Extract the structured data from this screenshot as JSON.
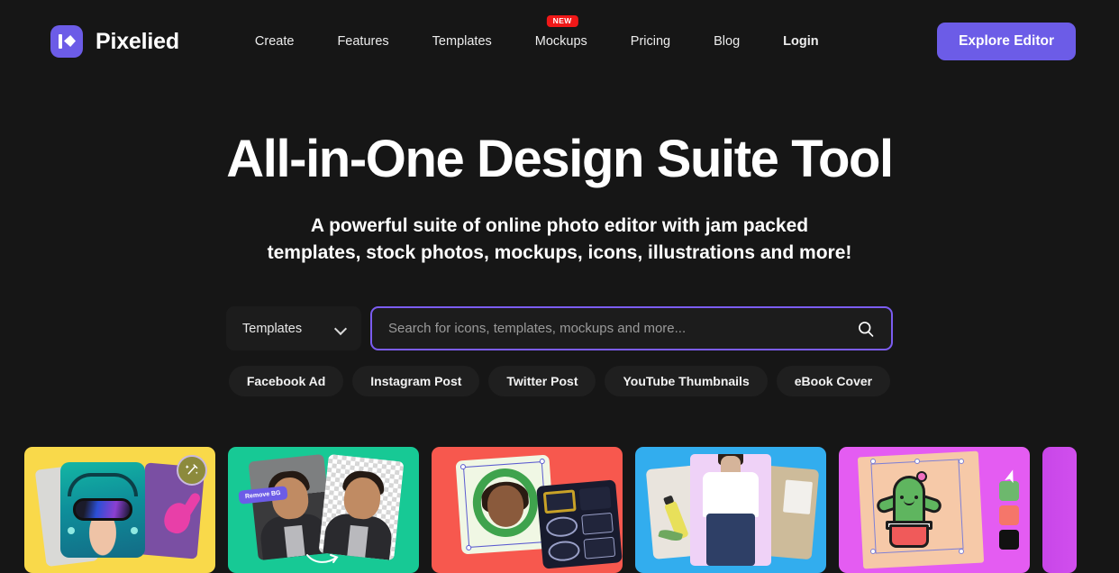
{
  "brand": {
    "name": "Pixelied",
    "logo_icon": "pixelied-logo-icon"
  },
  "nav": {
    "items": [
      {
        "label": "Create",
        "bold": false,
        "badge": ""
      },
      {
        "label": "Features",
        "bold": false,
        "badge": ""
      },
      {
        "label": "Templates",
        "bold": false,
        "badge": ""
      },
      {
        "label": "Mockups",
        "bold": false,
        "badge": "NEW"
      },
      {
        "label": "Pricing",
        "bold": false,
        "badge": ""
      },
      {
        "label": "Blog",
        "bold": false,
        "badge": ""
      },
      {
        "label": "Login",
        "bold": true,
        "badge": ""
      }
    ],
    "cta_label": "Explore Editor"
  },
  "hero": {
    "title": "All-in-One Design Suite Tool",
    "subtitle_line1": "A powerful suite of online photo editor with jam packed",
    "subtitle_line2": "templates, stock photos, mockups, icons, illustrations and more!"
  },
  "search": {
    "category_selected": "Templates",
    "category_icon": "chevron-down-icon",
    "placeholder": "Search for icons, templates, mockups and more...",
    "value": "",
    "submit_icon": "search-icon"
  },
  "quick_tags": [
    "Facebook Ad",
    "Instagram Post",
    "Twitter Post",
    "YouTube Thumbnails",
    "eBook Cover"
  ],
  "cards": [
    {
      "name": "ai-art-generator-card",
      "bg": "#F9D94A",
      "badge_icon": "magic-wand-icon",
      "caption": ""
    },
    {
      "name": "background-remover-card",
      "bg": "#17C995",
      "badge_label": "Remove BG",
      "caption": ""
    },
    {
      "name": "photo-frames-card",
      "bg": "#F7584E",
      "caption": ""
    },
    {
      "name": "mockups-card",
      "bg": "#32ADEE",
      "caption": ""
    },
    {
      "name": "illustrations-card",
      "bg": "#E45CF2",
      "caption": ""
    },
    {
      "name": "next-card-preview",
      "bg": "#D14FEE",
      "caption": ""
    }
  ],
  "colors": {
    "page_bg": "#161616",
    "accent_purple": "#6C5CE7",
    "input_border": "#7B5CF0",
    "badge_red": "#F01818",
    "surface": "#1C1C1C"
  }
}
